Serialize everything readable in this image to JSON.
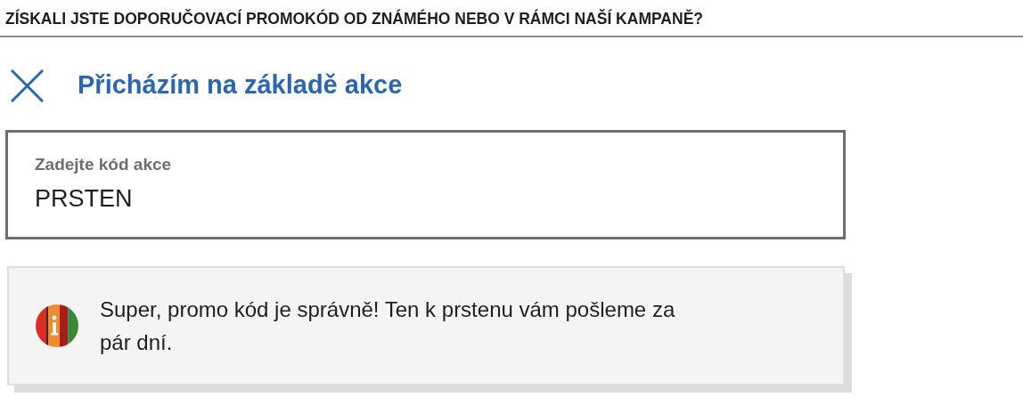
{
  "question": "ZÍSKALI JSTE DOPORUČOVACÍ PROMOKÓD OD ZNÁMÉHO NEBO V RÁMCI NAŠÍ KAMPANĚ?",
  "option": {
    "label": "Přicházím na základě akce"
  },
  "code_field": {
    "label": "Zadejte kód akce",
    "value": "PRSTEN"
  },
  "message": {
    "text": "Super, promo kód je správně! Ten k prstenu vám pošleme za pár dní."
  }
}
